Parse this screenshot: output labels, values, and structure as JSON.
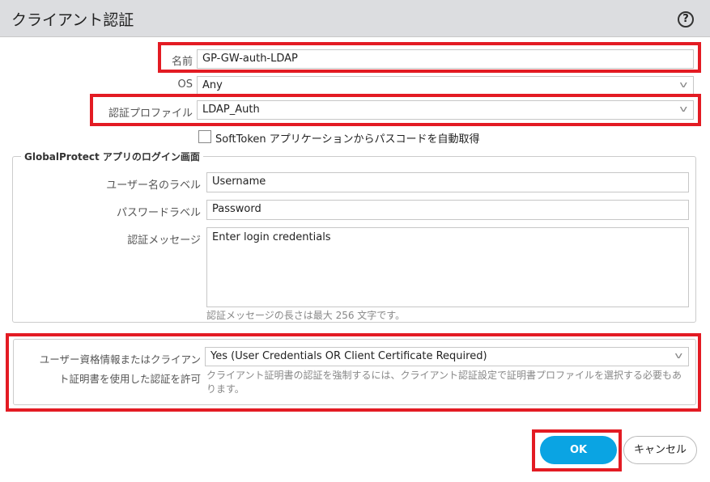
{
  "dialog": {
    "title": "クライアント認証",
    "help_icon": "?"
  },
  "form": {
    "name_label": "名前",
    "name_value": "GP-GW-auth-LDAP",
    "os_label": "OS",
    "os_value": "Any",
    "profile_label": "認証プロファイル",
    "profile_value": "LDAP_Auth",
    "softtoken_label": "SoftToken アプリケーションからパスコードを自動取得",
    "softtoken_checked": false
  },
  "login_screen": {
    "legend": "GlobalProtect アプリのログイン画面",
    "username_label": "ユーザー名のラベル",
    "username_value": "Username",
    "password_label": "パスワードラベル",
    "password_value": "Password",
    "message_label": "認証メッセージ",
    "message_value": "Enter login credentials",
    "message_hint": "認証メッセージの長さは最大 256 文字です。"
  },
  "cert": {
    "label_line1": "ユーザー資格情報またはクライアン",
    "label_line2": "ト証明書を使用した認証を許可",
    "value": "Yes (User Credentials OR Client Certificate Required)",
    "hint": "クライアント証明書の認証を強制するには、クライアント認証設定で証明書プロファイルを選択する必要もあります。"
  },
  "buttons": {
    "ok": "OK",
    "cancel": "キャンセル"
  }
}
